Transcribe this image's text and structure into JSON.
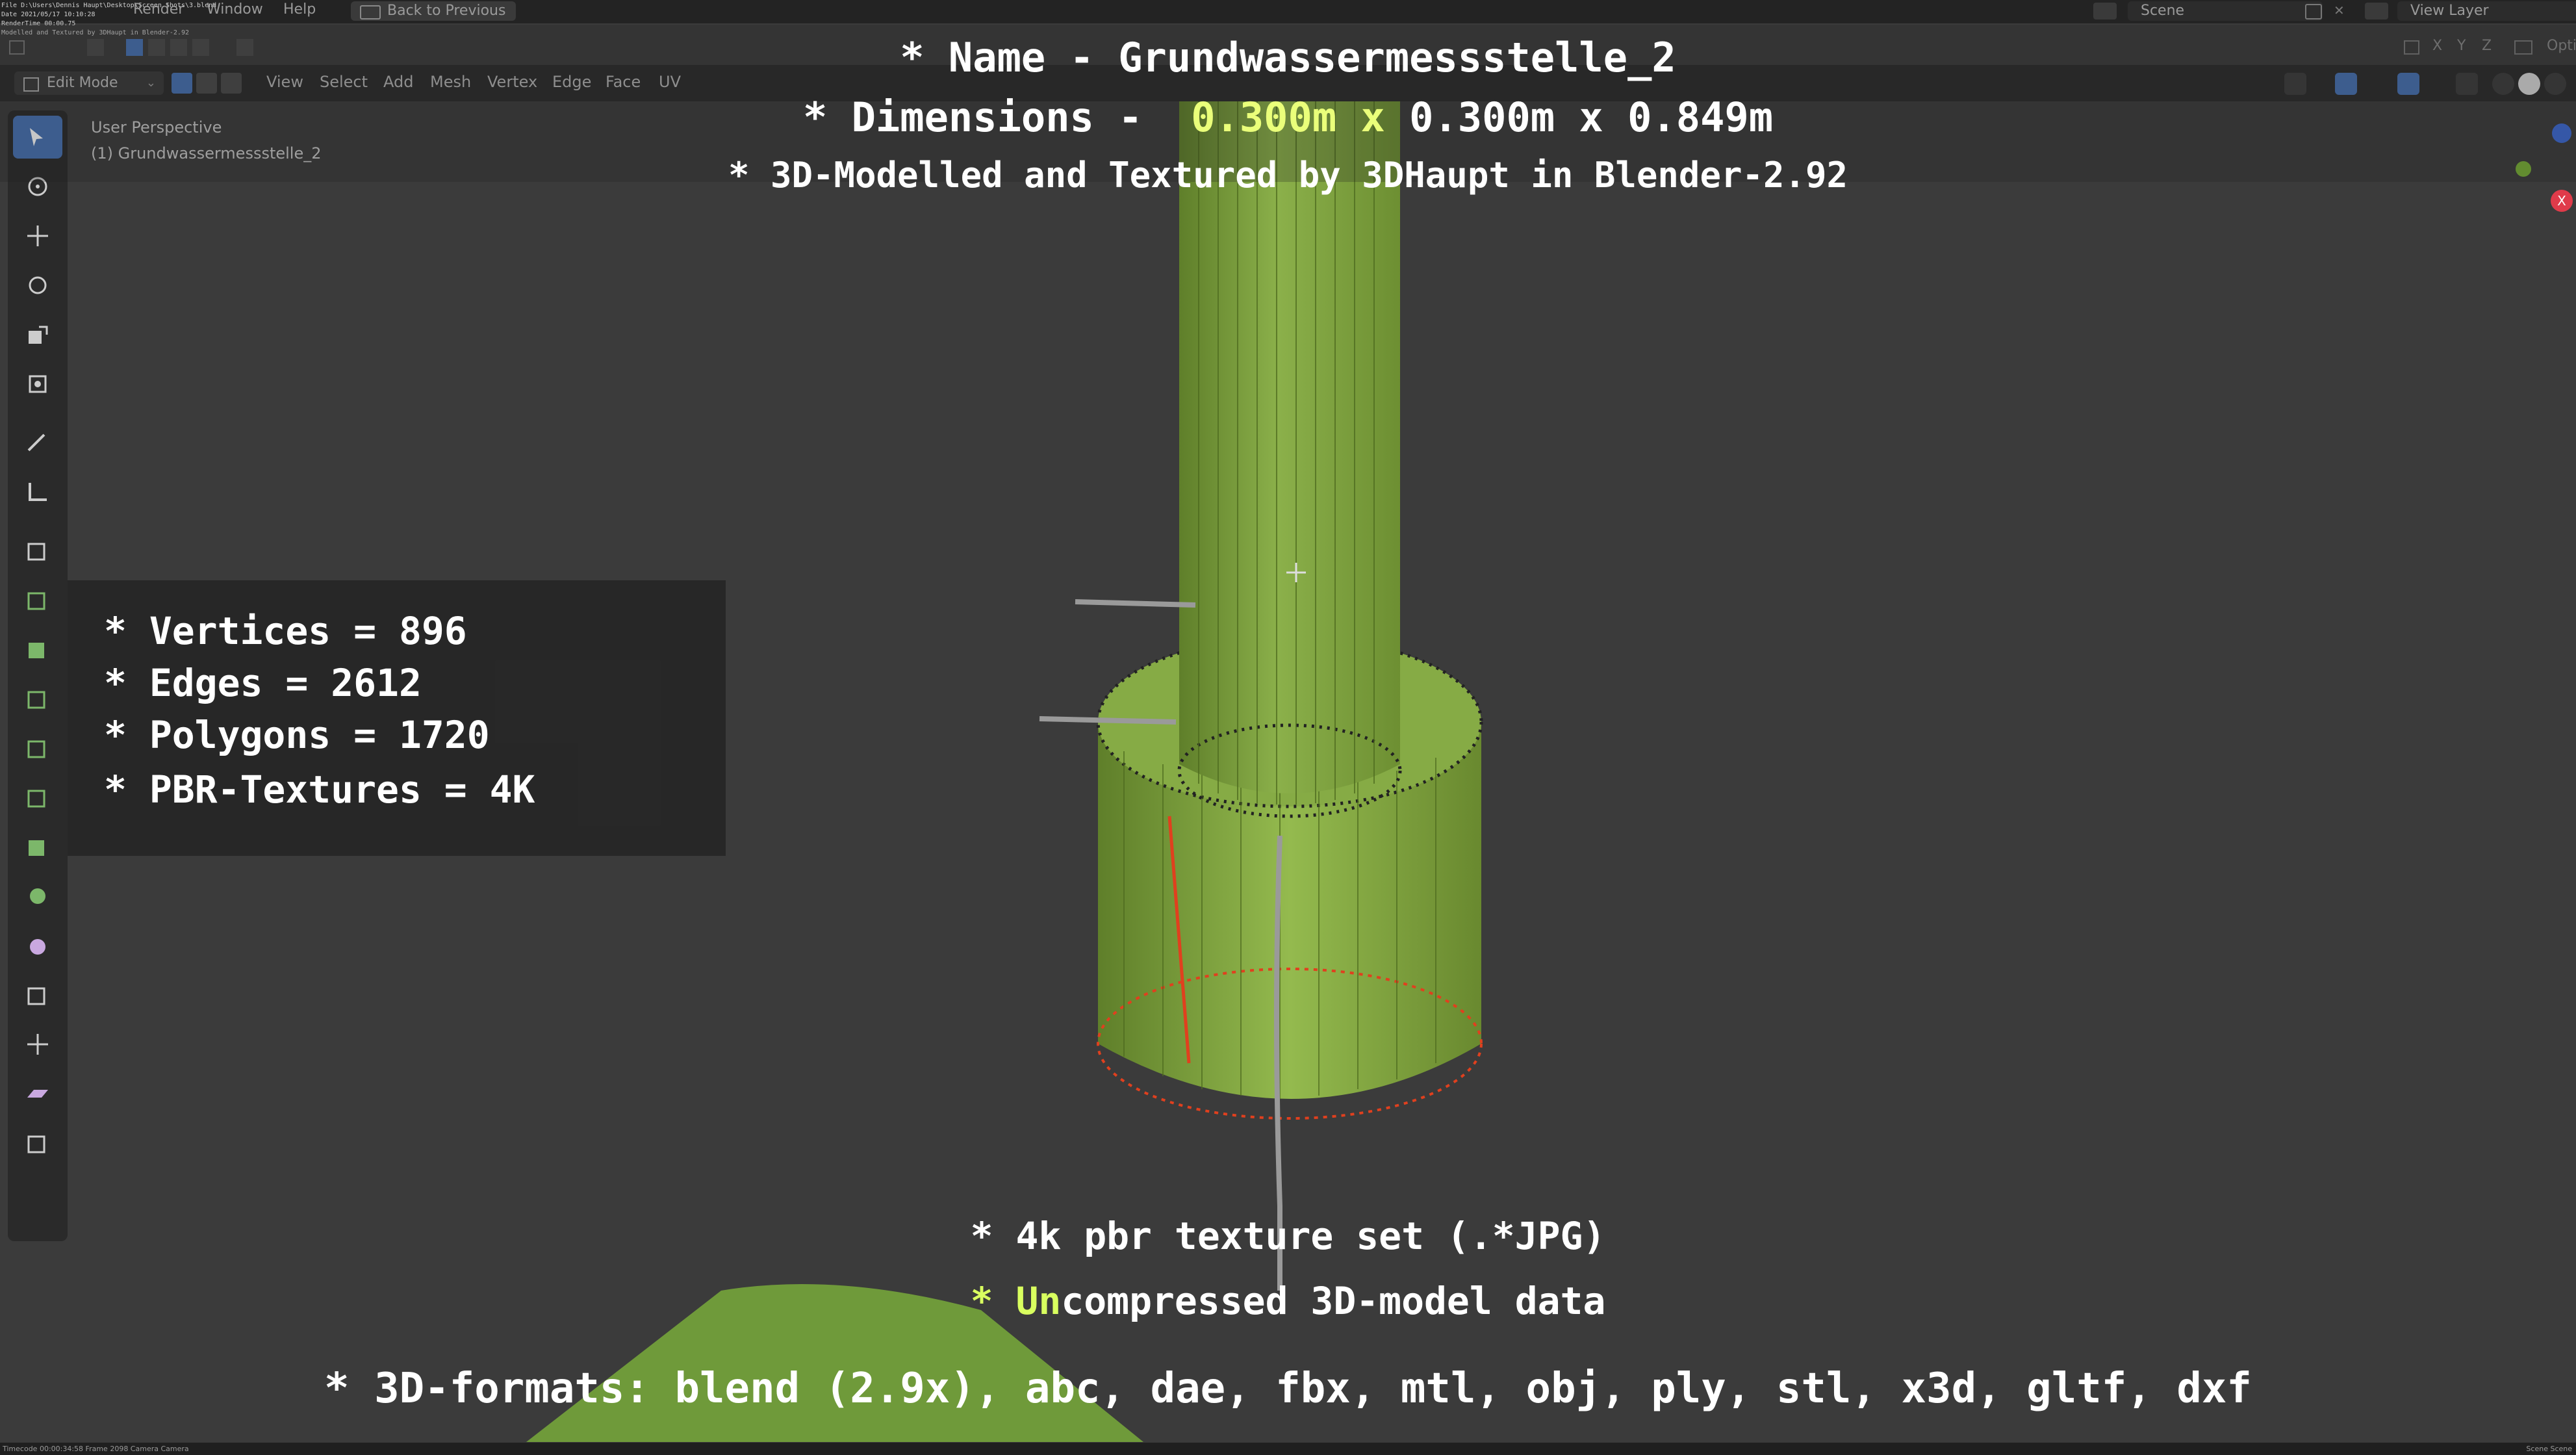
{
  "topbar": {
    "overlay_lines": [
      "File D:\\Users\\Dennis Haupt\\Desktop\\Screen Shots\\3.blend",
      "Date 2021/05/17 10:10:28",
      "RenderTime 00:00.75",
      "Modelled and Textured by 3DHaupt in Blender-2.92"
    ],
    "menu_help": "Help",
    "menu_render": "Render",
    "menu_window": "Window",
    "back_button": "Back to Previous",
    "scene_label": "Scene",
    "view_layer_label": "View Layer",
    "options_label": "Opti"
  },
  "header": {
    "mode": "Edit Mode",
    "menus": [
      "View",
      "Select",
      "Add",
      "Mesh",
      "Vertex",
      "Edge",
      "Face",
      "UV"
    ],
    "axis_toggles": [
      "X",
      "Y",
      "Z"
    ]
  },
  "viewport": {
    "perspective": "User Perspective",
    "object": "(1) Grundwassermessstelle_2",
    "gizmo_x": "X"
  },
  "title": {
    "line1": "* Name - Grundwassermessstelle_2",
    "line2_prefix": "* Dimensions -  ",
    "line2_highlight": "0.300m x",
    "line2_suffix": " 0.300m x 0.849m",
    "line3": "* 3D-Modelled and Textured by 3DHaupt in Blender-2.92"
  },
  "stats": {
    "vertices": "* Vertices = 896",
    "edges": "* Edges = 2612",
    "polygons": "* Polygons = 1720",
    "textures": "* PBR-Textures = 4K"
  },
  "bottom": {
    "line1": "* 4k pbr texture set (.*JPG)",
    "line2_highlight": "* Un",
    "line2_rest": "compressed 3D-model data",
    "line3": "* 3D-formats: blend (2.9x), abc, dae, fbx, mtl, obj, ply, stl, x3d, gltf, dxf"
  },
  "statusbar": {
    "left": "Timecode 00:00:34:58   Frame 2098   Camera Camera",
    "right": "Scene Scene"
  },
  "colors": {
    "mesh_green": "#8bb04a",
    "mesh_dark": "#5f7f2a",
    "seam_red": "#e0401e",
    "accent_blue": "#4772b3"
  },
  "icons": {
    "tools": [
      "select-box-icon",
      "cursor-icon",
      "move-icon",
      "rotate-icon",
      "scale-icon",
      "transform-icon",
      "annotate-icon",
      "measure-icon",
      "add-cube-icon",
      "extrude-region-icon",
      "inset-faces-icon",
      "bevel-icon",
      "loop-cut-icon",
      "knife-icon",
      "poly-build-icon",
      "spin-icon",
      "smooth-icon",
      "edge-slide-icon",
      "shrink-fatten-icon",
      "shear-icon",
      "rip-region-icon"
    ]
  }
}
